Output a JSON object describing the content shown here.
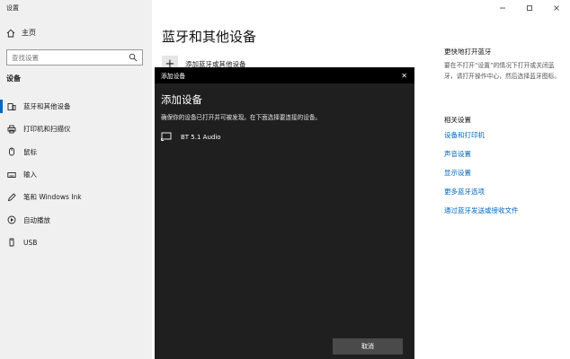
{
  "window": {
    "title": "设置"
  },
  "sidebar": {
    "home_label": "主页",
    "search_placeholder": "查找设置",
    "section_label": "设备",
    "items": [
      {
        "label": "蓝牙和其他设备",
        "icon": "bluetooth-devices-icon",
        "active": true
      },
      {
        "label": "打印机和扫描仪",
        "icon": "printer-icon"
      },
      {
        "label": "鼠标",
        "icon": "mouse-icon"
      },
      {
        "label": "输入",
        "icon": "keyboard-icon"
      },
      {
        "label": "笔和 Windows Ink",
        "icon": "pen-icon"
      },
      {
        "label": "自动播放",
        "icon": "autoplay-icon"
      },
      {
        "label": "USB",
        "icon": "usb-icon"
      }
    ]
  },
  "main": {
    "title": "蓝牙和其他设备",
    "add_device_label": "添加蓝牙或其他设备"
  },
  "right_panel": {
    "heading": "更快地打开蓝牙",
    "description": "要在不打开“设置”的情况下打开或关闭蓝牙，请打开操作中心，然后选择蓝牙图标。",
    "related_heading": "相关设置",
    "links": [
      "设备和打印机",
      "声音设置",
      "显示设置",
      "更多蓝牙选项",
      "通过蓝牙发送或接收文件"
    ]
  },
  "dialog": {
    "titlebar": "添加设备",
    "close_glyph": "✕",
    "heading": "添加设备",
    "subtitle": "确保你的设备已打开并可被发现。在下面选择要连接的设备。",
    "devices": [
      {
        "name": "BT 5.1 Audio",
        "icon": "audio-device-icon"
      }
    ],
    "cancel_label": "取消"
  },
  "colors": {
    "accent": "#0067c0",
    "dialog_bg": "#1f1f1f",
    "dialog_titlebar": "#000000",
    "sidebar_bg": "#f0f0f0"
  }
}
